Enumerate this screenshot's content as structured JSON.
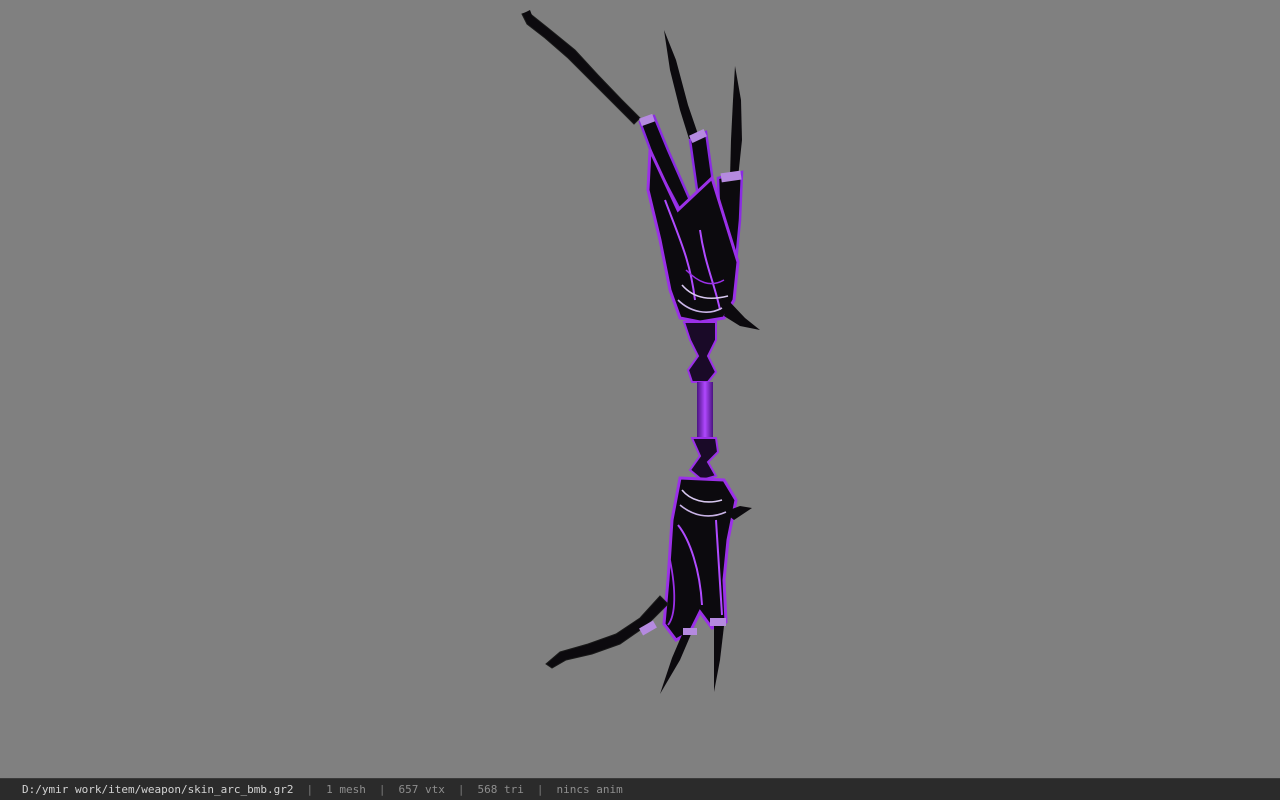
{
  "viewer": {
    "model_icon": "bow-model-icon"
  },
  "status_bar": {
    "file_path": "D:/ymir work/item/weapon/skin_arc_bmb.gr2",
    "separator": "|",
    "mesh_count": "1 mesh",
    "vertex_count": "657 vtx",
    "triangle_count": "568 tri",
    "anim_status": "nincs anim"
  },
  "colors": {
    "background": "#808080",
    "status_bar": "#2b2b2b",
    "model_body": "#0c0a0e",
    "model_glow": "#9b30e8",
    "model_accent": "#c9b3e6"
  }
}
